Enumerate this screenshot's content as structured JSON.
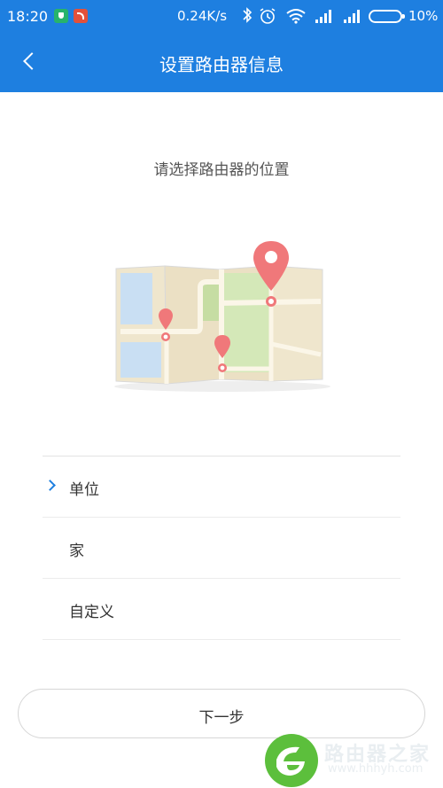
{
  "status_bar": {
    "time": "18:20",
    "network_speed": "0.24K/s",
    "battery_level": "10%",
    "icons": [
      "shield-app-icon",
      "wifi-app-icon",
      "bluetooth-icon",
      "alarm-icon",
      "wifi-icon",
      "signal-icon",
      "signal-icon",
      "battery-icon"
    ]
  },
  "header": {
    "title": "设置路由器信息",
    "back_icon": "chevron-left-icon"
  },
  "main": {
    "prompt": "请选择路由器的位置",
    "illustration": "map-with-location-pins",
    "options": [
      {
        "label": "单位",
        "selected": true
      },
      {
        "label": "家",
        "selected": false
      },
      {
        "label": "自定义",
        "selected": false
      }
    ]
  },
  "footer": {
    "next_label": "下一步"
  },
  "watermark": {
    "text": "路由器之家",
    "url": "www.hhhyh.com"
  },
  "colors": {
    "accent": "#1e7fe0",
    "pin": "#f0787a",
    "map_green": "#d4e8b8",
    "map_beige": "#ebe0c4",
    "map_water": "#c9dff3"
  }
}
